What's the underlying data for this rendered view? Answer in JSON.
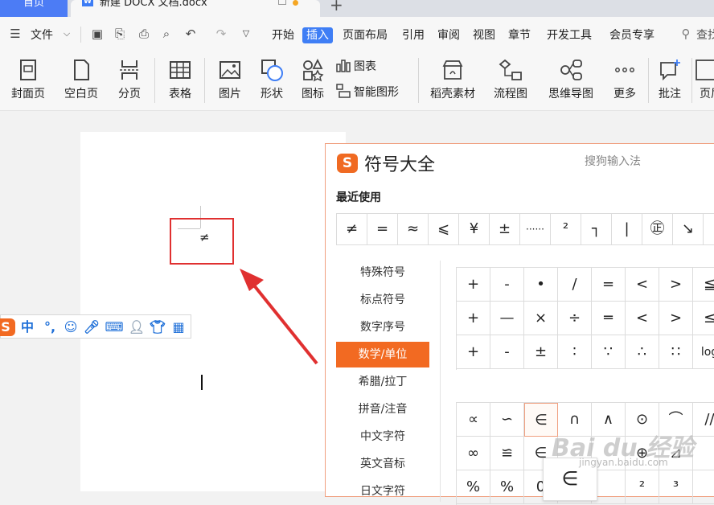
{
  "tabs": {
    "home": "首页",
    "doc_title": "新建 DOCX 文档.docx",
    "add": "+"
  },
  "menu": {
    "file": "文件",
    "items": [
      "开始",
      "插入",
      "页面布局",
      "引用",
      "审阅",
      "视图",
      "章节",
      "开发工具",
      "会员专享"
    ],
    "active": "插入",
    "search": "查找"
  },
  "ribbon": {
    "cover": "封面页",
    "blank": "空白页",
    "pagebreak": "分页",
    "table": "表格",
    "picture": "图片",
    "shape": "形状",
    "icon": "图标",
    "chart": "图表",
    "smartart": "智能图形",
    "material": "稻壳素材",
    "flowchart": "流程图",
    "mindmap": "思维导图",
    "more": "更多",
    "comment": "批注",
    "header": "页眉"
  },
  "document": {
    "inserted_symbol": "≠"
  },
  "ime": {
    "mode": "中",
    "punct": "°,"
  },
  "panel": {
    "title": "符号大全",
    "brand": "搜狗输入法",
    "recent_title": "最近使用",
    "recent": [
      "≠",
      "=",
      "≈",
      "⩽",
      "¥",
      "±",
      "······",
      "²",
      "┐",
      "|",
      "㊣",
      "↘"
    ],
    "categories": [
      "特殊符号",
      "标点符号",
      "数字序号",
      "数学/单位",
      "希腊/拉丁",
      "拼音/注音",
      "中文字符",
      "英文音标",
      "日文字符"
    ],
    "active_category": "数学/单位",
    "grid1": [
      [
        "+",
        "-",
        "•",
        "/",
        "=",
        "<",
        ">",
        "≦"
      ],
      [
        "+",
        "—",
        "×",
        "÷",
        "═",
        "<",
        ">",
        "≤"
      ],
      [
        "+",
        "-",
        "±",
        "∶",
        "∵",
        "∴",
        "∷",
        "log"
      ]
    ],
    "grid2": [
      [
        "∝",
        "∽",
        "∈",
        "∩",
        "∧",
        "⊙",
        "⌒",
        "//"
      ],
      [
        "∞",
        "≌",
        "∈",
        "",
        "",
        "⊕",
        "⊿",
        ""
      ],
      [
        "%",
        "%",
        "0",
        "",
        "",
        "²",
        "³",
        ""
      ]
    ],
    "hover_symbol": "∈"
  },
  "watermark": {
    "main": "Bai du 经验",
    "sub": "jingyan.baidu.com"
  },
  "colors": {
    "accent_blue": "#3f7ef5",
    "sogou_orange": "#f26a22",
    "highlight_red": "#e03030"
  }
}
